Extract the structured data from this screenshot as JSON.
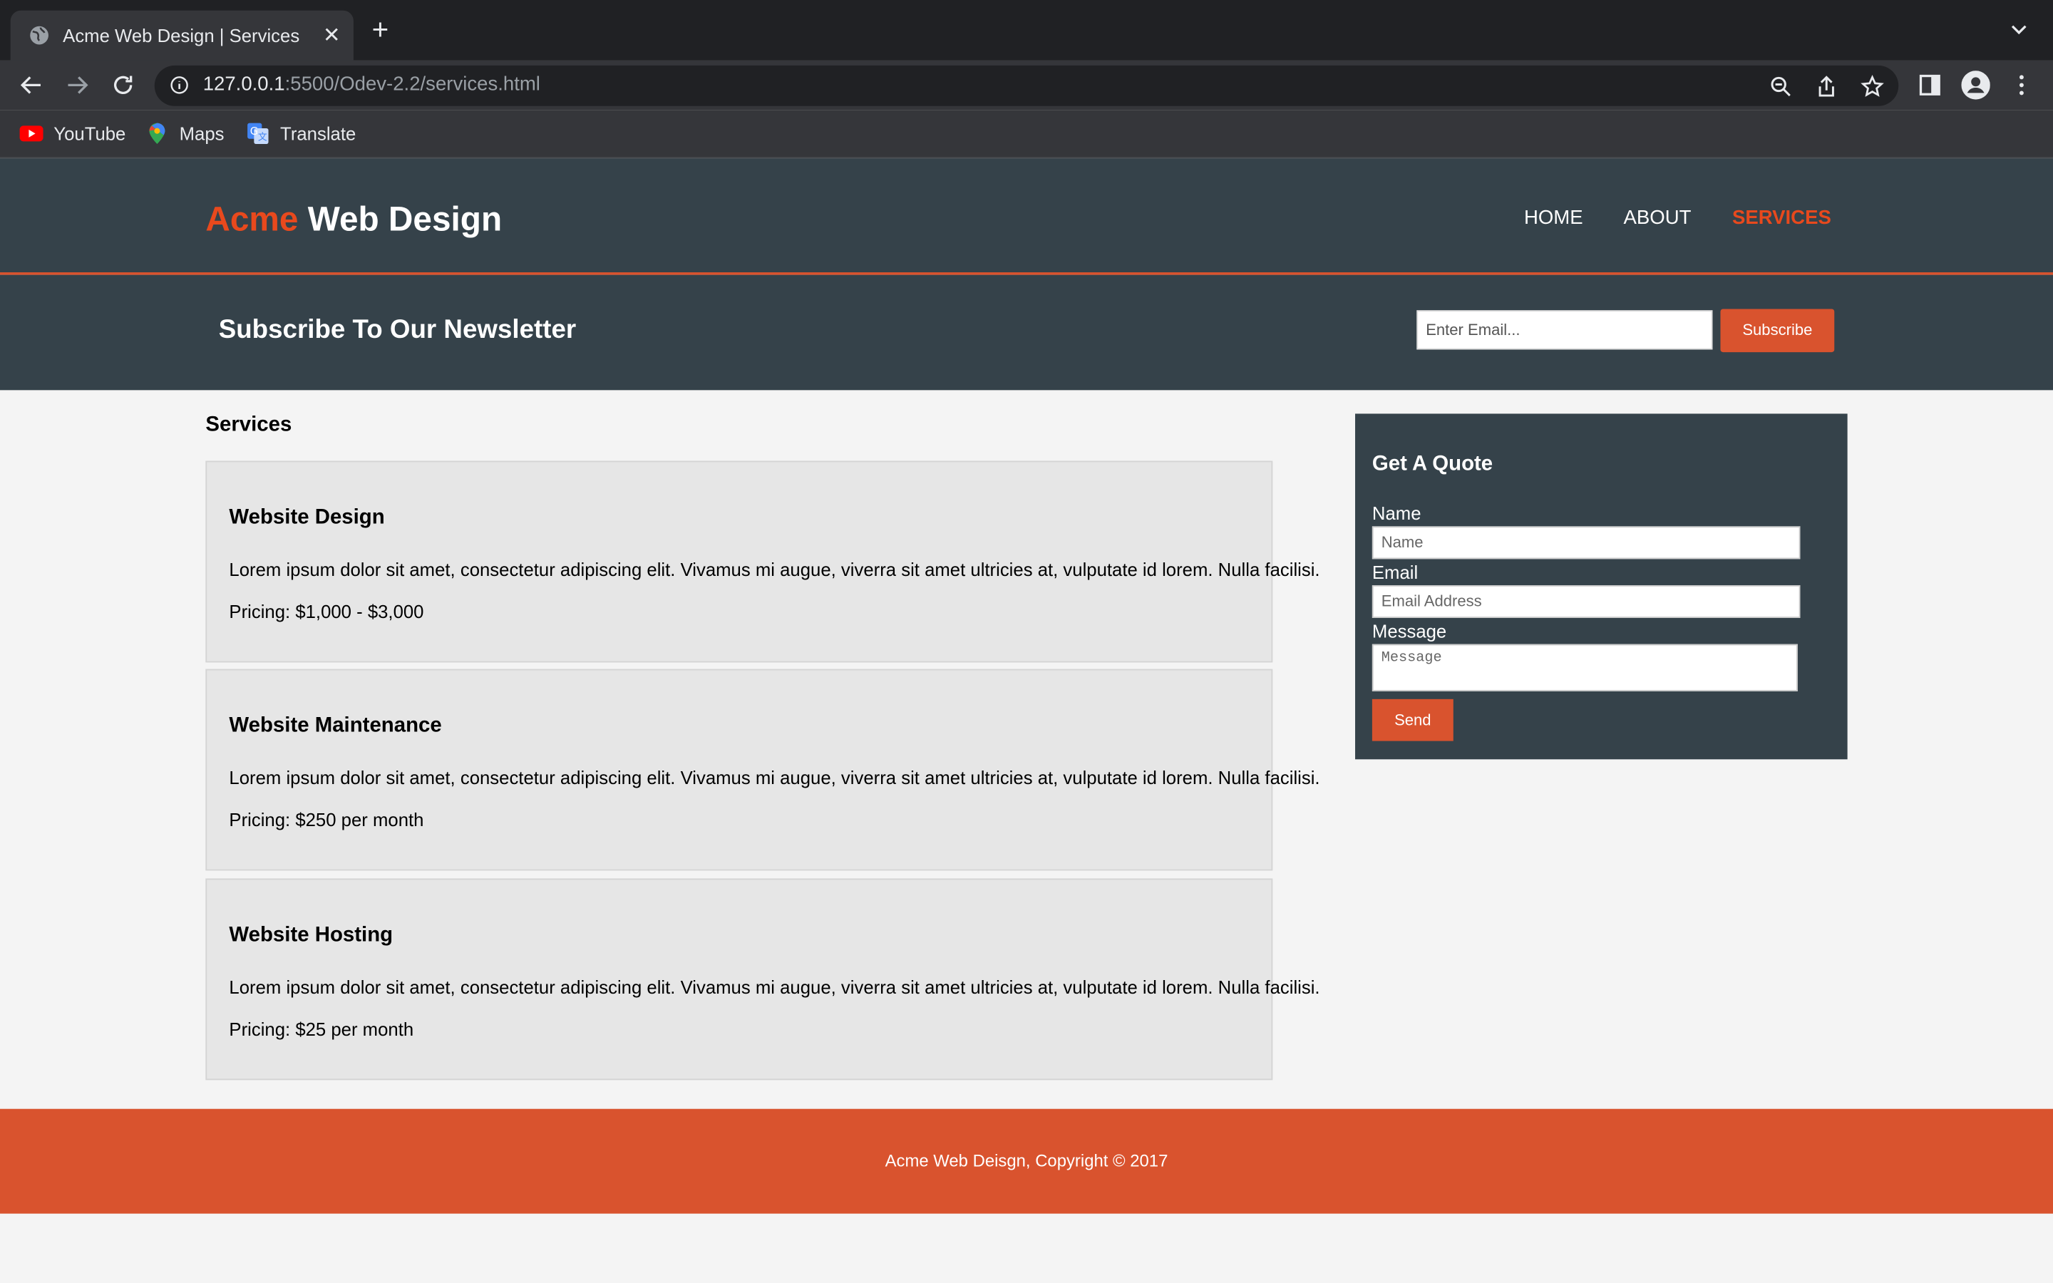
{
  "browser": {
    "tab_title": "Acme Web Design | Services",
    "url_host": "127.0.0.1",
    "url_path": ":5500/Odev-2.2/services.html",
    "bookmarks": [
      "YouTube",
      "Maps",
      "Translate"
    ]
  },
  "header": {
    "logo_highlight": "Acme",
    "logo_rest": " Web Design",
    "nav": [
      "HOME",
      "ABOUT",
      "SERVICES"
    ],
    "active_nav": "SERVICES"
  },
  "newsletter": {
    "title": "Subscribe To Our Newsletter",
    "email_placeholder": "Enter Email...",
    "button": "Subscribe"
  },
  "services": {
    "title": "Services",
    "items": [
      {
        "name": "Website Design",
        "desc": "Lorem ipsum dolor sit amet, consectetur adipiscing elit. Vivamus mi augue, viverra sit amet ultricies at, vulputate id lorem. Nulla facilisi.",
        "price": "Pricing: $1,000 - $3,000"
      },
      {
        "name": "Website Maintenance",
        "desc": "Lorem ipsum dolor sit amet, consectetur adipiscing elit. Vivamus mi augue, viverra sit amet ultricies at, vulputate id lorem. Nulla facilisi.",
        "price": "Pricing: $250 per month"
      },
      {
        "name": "Website Hosting",
        "desc": "Lorem ipsum dolor sit amet, consectetur adipiscing elit. Vivamus mi augue, viverra sit amet ultricies at, vulputate id lorem. Nulla facilisi.",
        "price": "Pricing: $25 per month"
      }
    ]
  },
  "quote": {
    "title": "Get A Quote",
    "name_label": "Name",
    "name_placeholder": "Name",
    "email_label": "Email",
    "email_placeholder": "Email Address",
    "message_label": "Message",
    "message_placeholder": "Message",
    "button": "Send"
  },
  "footer": {
    "text": "Acme Web Deisgn, Copyright © 2017"
  },
  "colors": {
    "accent": "#e8491d",
    "button": "#d9532e",
    "dark": "#35424a"
  }
}
